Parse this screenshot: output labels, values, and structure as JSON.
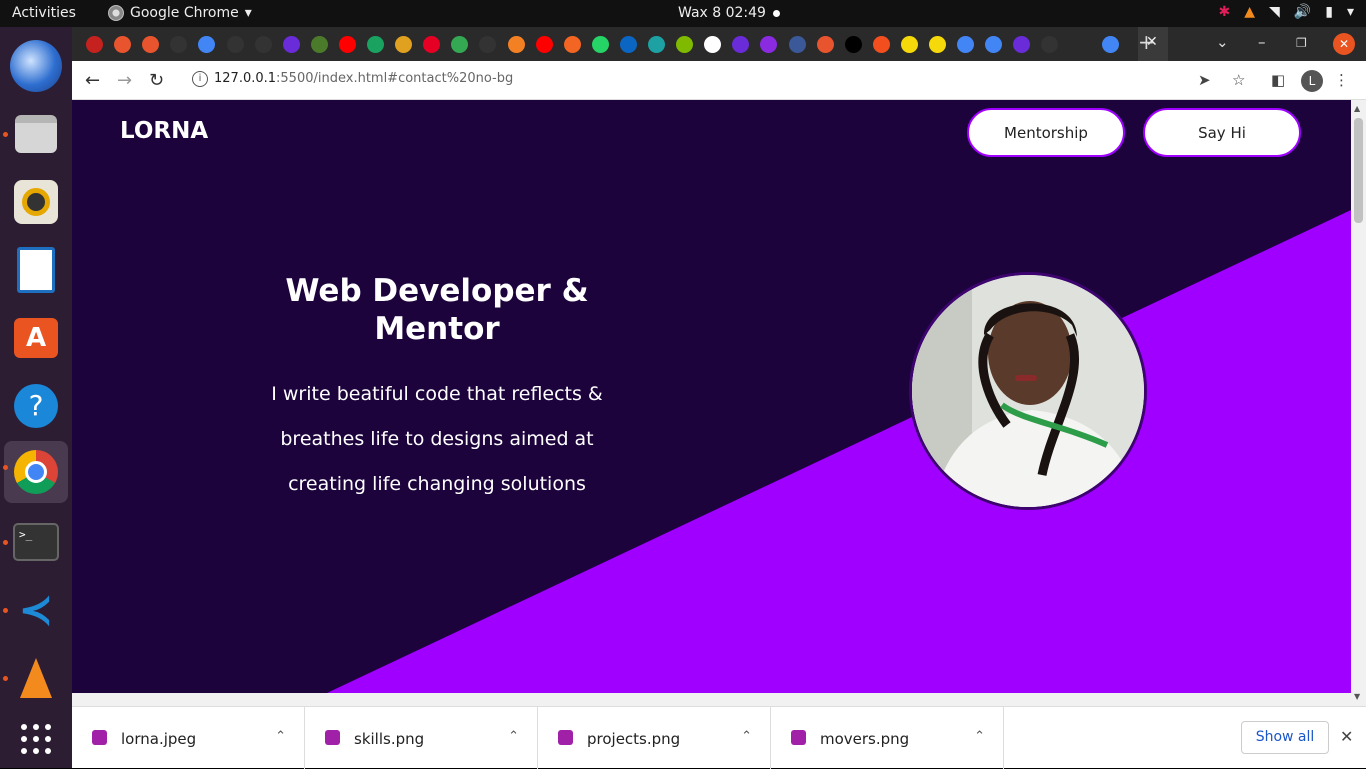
{
  "system": {
    "activities": "Activities",
    "app_name": "Google Chrome",
    "clock": "Wax 8  02:49"
  },
  "browser": {
    "url_host": "127.0.0.1",
    "url_rest": ":5500/index.html#contact%20no-bg",
    "profile_initial": "L"
  },
  "page": {
    "logo": "LORNA",
    "nav": [
      "Mentorship",
      "Say Hi"
    ],
    "hero_title": "Web Developer & Mentor",
    "hero_lines": [
      "I write beatiful code that reflects &",
      "breathes life to designs aimed at",
      "creating life changing solutions"
    ],
    "colors": {
      "background": "#1c033c",
      "accent": "#9f00ff"
    }
  },
  "downloads": {
    "items": [
      "lorna.jpeg",
      "skills.png",
      "projects.png",
      "movers.png"
    ],
    "show_all": "Show all"
  }
}
